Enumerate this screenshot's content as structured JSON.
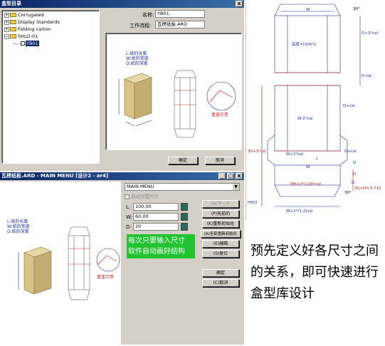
{
  "top_window": {
    "title": "盒型目录",
    "tree": [
      "Corrugated",
      "Display Standards",
      "Folding carton",
      "SHLO-01",
      "YB01"
    ],
    "name_label": "名称:",
    "name_value": "YB01",
    "process_label": "工作流程:",
    "process_value": "瓦楞纸板.ARD",
    "diagram_labels": {
      "l": "L:纸的长度",
      "w": "W:纸的宽度",
      "d": "D:纸的深度",
      "cap": "盒盖示意"
    },
    "ok": "确定",
    "cancel": "取消"
  },
  "bottom_window": {
    "title": "瓦楞纸板.ARD - MAIN MENU [设计2 - ar4]",
    "menu_select": "MAIN MENU",
    "checkbox_label": "自动设置尺寸",
    "fields": [
      {
        "label": "L:",
        "value": "100.00"
      },
      {
        "label": "W:",
        "value": "60.00"
      },
      {
        "label": "D:",
        "value": "20"
      }
    ],
    "buttons": [
      "(N)下一个",
      "(P)先前的",
      "(K)重新初始化",
      "(A)全部重新初始化",
      "(E)编辑",
      "(S)复位",
      "确定",
      "(C)取消"
    ],
    "note_line1": "每次只要输入尺寸",
    "note_line2": "软件自动画好结构",
    "diagram_labels": {
      "l": "L:纸的长度",
      "w": "W:纸的宽度",
      "d": "D:纸的深度",
      "cap": "盒盖示意"
    },
    "win_controls": [
      "_",
      "□",
      "x"
    ]
  },
  "drawing": {
    "labels": [
      "30°",
      "W",
      "D+2*cal",
      "高度=(3/4)*L",
      "D-cal",
      "D+cal",
      "W-2*cal",
      "30+3*cal",
      "W+2*cal",
      "D+cal",
      "L",
      "D",
      "W",
      "D",
      "HH+2*(1/4)*cal",
      "D",
      "30+HH-0.732",
      "30°",
      "HH/2",
      "W+2*(1.2)cal"
    ]
  },
  "caption": "预先定义好各尺寸之间的关系，即可快速进行盒型库设计",
  "colors": {
    "titlebar": "#0a246a",
    "accent_green": "#21c430",
    "box_tan": "#d8c388",
    "red": "#d02020",
    "blue": "#2030a0"
  }
}
